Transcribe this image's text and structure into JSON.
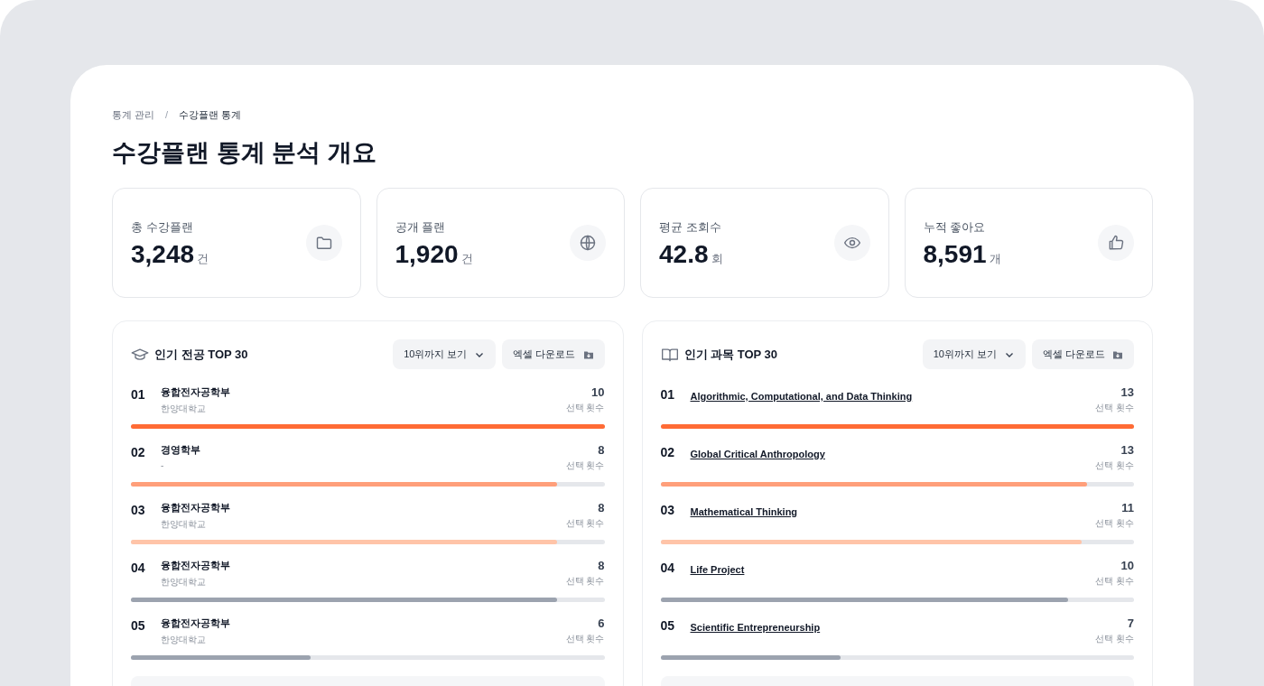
{
  "breadcrumb": [
    {
      "label": "통계 관리",
      "selected": false
    },
    {
      "label": "수강플랜 통계",
      "selected": true
    }
  ],
  "breadcrumb_separator": "/",
  "title": "수강플랜 통계 분석 개요",
  "stats": [
    {
      "label": "총 수강플랜",
      "value": "3,248",
      "unit": "건"
    },
    {
      "label": "공개 플랜",
      "value": "1,920",
      "unit": "건"
    },
    {
      "label": "평균 조회수",
      "value": "42.8",
      "unit": "회"
    },
    {
      "label": "누적 좋아요",
      "value": "8,591",
      "unit": "개"
    }
  ],
  "panels": [
    {
      "kind": "major",
      "title": "인기 전공 TOP 30",
      "range_button": "10위까지 보기",
      "download_button": "엑셀 다운로드",
      "items": [
        {
          "rank": "01",
          "name": "융합전자공학부",
          "sub": "한양대학교",
          "count": "10",
          "count_label": "선택 횟수",
          "level": 1,
          "color": "#ff6b35"
        },
        {
          "rank": "02",
          "name": "경영학부",
          "sub": "-",
          "count": "8",
          "count_label": "선택 횟수",
          "level": 0.9,
          "color": "#ff9f7a"
        },
        {
          "rank": "03",
          "name": "융합전자공학부",
          "sub": "한양대학교",
          "count": "8",
          "count_label": "선택 횟수",
          "level": 0.9,
          "color": "#ffc4a8"
        },
        {
          "rank": "04",
          "name": "융합전자공학부",
          "sub": "한양대학교",
          "count": "8",
          "count_label": "선택 횟수",
          "level": 0.9,
          "color": "#9ca3af"
        },
        {
          "rank": "05",
          "name": "융합전자공학부",
          "sub": "한양대학교",
          "count": "6",
          "count_label": "선택 횟수",
          "level": 0.38,
          "color": "#9ca3af"
        }
      ]
    },
    {
      "kind": "course",
      "title": "인기 과목 TOP 30",
      "range_button": "10위까지 보기",
      "download_button": "엑셀 다운로드",
      "items": [
        {
          "rank": "01",
          "name": "Algorithmic, Computational, and Data Thinking",
          "count": "13",
          "count_label": "선택 횟수",
          "level": 1,
          "color": "#ff6b35"
        },
        {
          "rank": "02",
          "name": "Global Critical Anthropology",
          "count": "13",
          "count_label": "선택 횟수",
          "level": 0.9,
          "color": "#ff9f7a"
        },
        {
          "rank": "03",
          "name": "Mathematical Thinking",
          "count": "11",
          "count_label": "선택 횟수",
          "level": 0.89,
          "color": "#ffc4a8"
        },
        {
          "rank": "04",
          "name": "Life Project",
          "count": "10",
          "count_label": "선택 횟수",
          "level": 0.86,
          "color": "#9ca3af"
        },
        {
          "rank": "05",
          "name": "Scientific Entrepreneurship",
          "count": "7",
          "count_label": "선택 횟수",
          "level": 0.38,
          "color": "#9ca3af"
        }
      ]
    }
  ]
}
